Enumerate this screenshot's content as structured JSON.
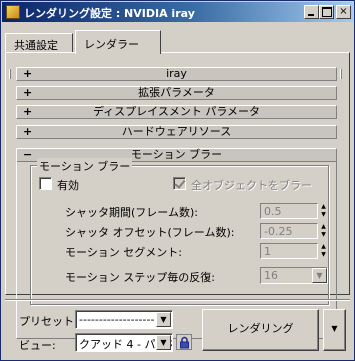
{
  "window": {
    "title": "レンダリング設定 : NVIDIA iray",
    "controls": {
      "minimize": "minimize",
      "maximize": "maximize",
      "close": "×"
    }
  },
  "tabs": [
    {
      "label": "共通設定",
      "active": false
    },
    {
      "label": "レンダラー",
      "active": true
    }
  ],
  "rollouts": [
    {
      "sign": "+",
      "title": "iray"
    },
    {
      "sign": "+",
      "title": "拡張パラメータ"
    },
    {
      "sign": "+",
      "title": "ディスプレイスメント パラメータ"
    },
    {
      "sign": "+",
      "title": "ハードウェアリソース"
    },
    {
      "sign": "−",
      "title": "モーション ブラー"
    }
  ],
  "motion_blur": {
    "group_label": "モーション ブラー",
    "enable_label": "有効",
    "enable_checked": false,
    "all_objects_label": "全オブジェクトをブラー",
    "all_objects_checked": true,
    "shutter_duration_label": "シャッタ期間(フレーム数):",
    "shutter_duration_value": "0.5",
    "shutter_offset_label": "シャッタ オフセット(フレーム数):",
    "shutter_offset_value": "-0.25",
    "motion_segments_label": "モーション セグメント:",
    "motion_segments_value": "1",
    "time_samples_label": "モーション ステップ毎の反復:",
    "time_samples_value": "16"
  },
  "footer": {
    "preset_label": "プリセット:",
    "preset_value": "-------------------",
    "view_label": "ビュー:",
    "view_value": "クアッド 4 - パース",
    "render_button": "レンダリング",
    "render_dropdown": "▼"
  },
  "icons": {
    "app": "teapot-render-icon",
    "lock": "lock-icon"
  }
}
